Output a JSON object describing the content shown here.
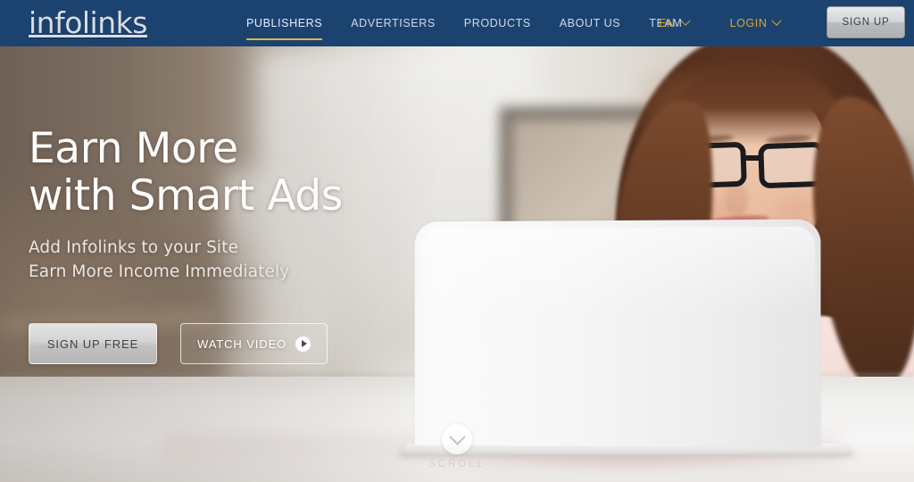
{
  "navbar": {
    "logo_text": "infolinks",
    "main_links": [
      {
        "label": "PUBLISHERS",
        "active": true
      },
      {
        "label": "ADVERTISERS",
        "active": false
      },
      {
        "label": "PRODUCTS",
        "active": false
      },
      {
        "label": "ABOUT US",
        "active": false
      },
      {
        "label": "TEAM",
        "active": false
      }
    ],
    "language": {
      "label": "EN"
    },
    "login": {
      "label": "LOGIN"
    },
    "signup_button": "SIGN UP",
    "background_color": "#1c4370",
    "active_underline_color": "#e2b33c",
    "utility_link_color": "#d9a53a"
  },
  "hero": {
    "headline_line1": "Earn More",
    "headline_line2": "with Smart Ads",
    "subline1": "Add Infolinks to your Site",
    "subline2": "Earn More Income Immediately",
    "cta_primary": "SIGN UP FREE",
    "cta_secondary": "WATCH VIDEO",
    "scroll_label": "SCROLL"
  }
}
